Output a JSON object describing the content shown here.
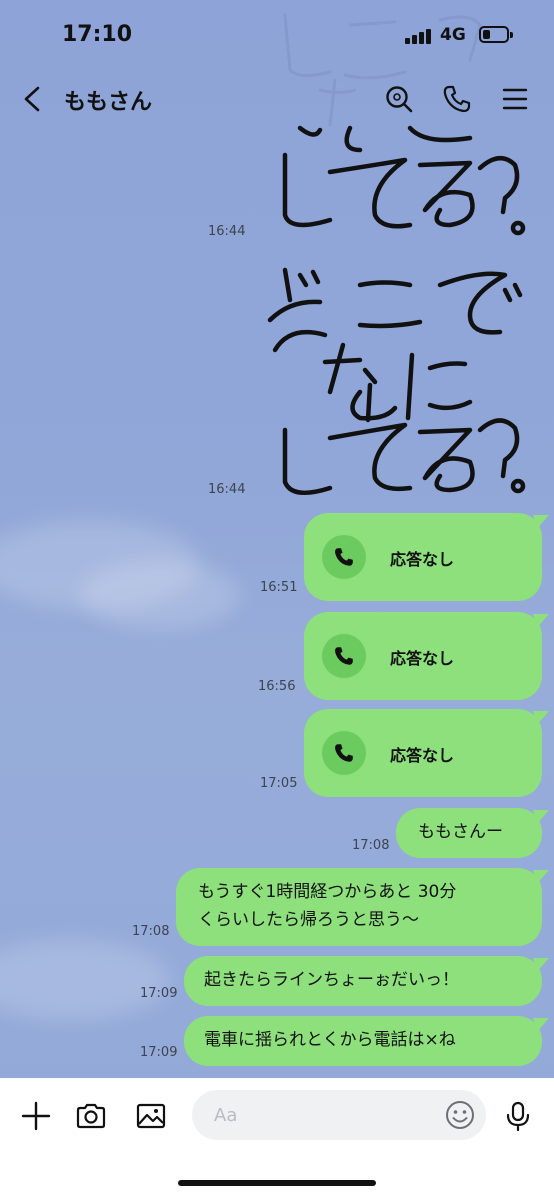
{
  "status_bar": {
    "time": "17:10",
    "network": "4G",
    "battery_level": 0.2
  },
  "header": {
    "title": "ももさん",
    "icons": [
      "back-icon",
      "search-icon",
      "phone-icon",
      "menu-icon"
    ]
  },
  "handwritten_messages": [
    {
      "lines": [
        "なに",
        "してる？"
      ],
      "time": "16:44"
    },
    {
      "lines": [
        "どこで",
        "なに",
        "してる？"
      ],
      "time": "16:44"
    }
  ],
  "call_messages": [
    {
      "label": "応答なし",
      "time": "16:51"
    },
    {
      "label": "応答なし",
      "time": "16:56"
    },
    {
      "label": "応答なし",
      "time": "17:05"
    }
  ],
  "text_messages": [
    {
      "lines": [
        "ももさんー"
      ],
      "time": "17:08"
    },
    {
      "lines": [
        "もうすぐ1時間経つからあと 30分",
        "くらいしたら帰ろうと思う〜"
      ],
      "time": "17:08"
    },
    {
      "lines": [
        "起きたらラインちょーぉだいっ！"
      ],
      "time": "17:09"
    },
    {
      "lines": [
        "電車に揺られとくから電話は×ね"
      ],
      "time": "17:09"
    }
  ],
  "input": {
    "placeholder": "Aa",
    "value": ""
  },
  "bottom_icons": [
    "plus-icon",
    "camera-icon",
    "image-icon",
    "emoji-icon",
    "mic-icon"
  ],
  "colors": {
    "background": "#8fa5d6",
    "bubble": "#8de07c",
    "call_circle": "#6ccb5f",
    "ink": "#111111"
  }
}
